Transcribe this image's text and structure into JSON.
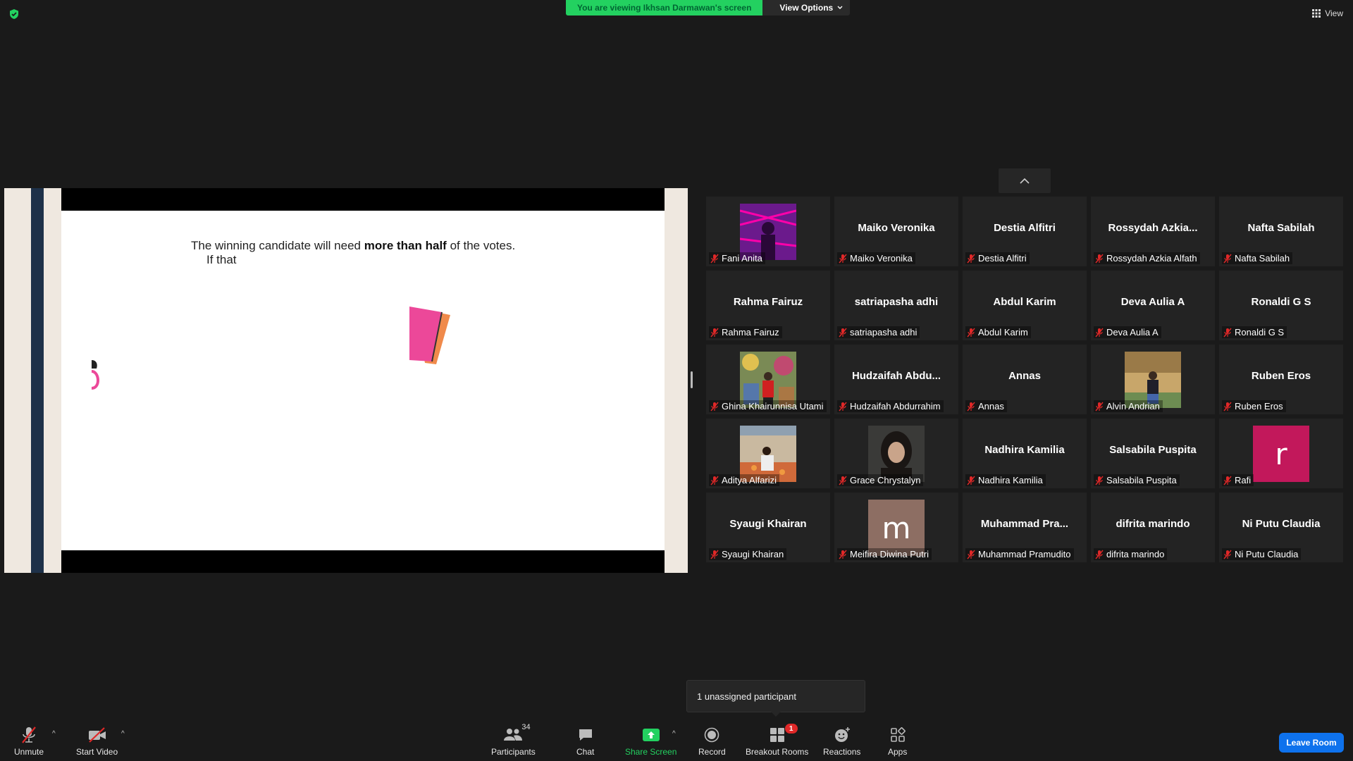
{
  "top": {
    "viewing_text": "You are viewing Ikhsan Darmawan's screen",
    "view_options_label": "View Options",
    "view_label": "View"
  },
  "slide": {
    "line1_pre": "The winning candidate will need ",
    "line1_bold": "more than half",
    "line1_post": " of the votes.",
    "line2": "If that"
  },
  "participants": [
    {
      "big": "",
      "name": "Fani Anita",
      "media": "photo-purple"
    },
    {
      "big": "Maiko Veronika",
      "name": "Maiko Veronika"
    },
    {
      "big": "Destia Alfitri",
      "name": "Destia Alfitri"
    },
    {
      "big": "Rossydah  Azkia...",
      "name": "Rossydah Azkia Alfath"
    },
    {
      "big": "Nafta Sabilah",
      "name": "Nafta Sabilah"
    },
    {
      "big": "Rahma Fairuz",
      "name": "Rahma Fairuz"
    },
    {
      "big": "satriapasha adhi",
      "name": "satriapasha adhi"
    },
    {
      "big": "Abdul Karim",
      "name": "Abdul Karim"
    },
    {
      "big": "Deva Aulia A",
      "name": "Deva Aulia A"
    },
    {
      "big": "Ronaldi G S",
      "name": "Ronaldi G S"
    },
    {
      "big": "",
      "name": "Ghina Khairunnisa Utami",
      "media": "photo-mural"
    },
    {
      "big": "Hudzaifah  Abdu...",
      "name": "Hudzaifah Abdurrahim"
    },
    {
      "big": "Annas",
      "name": "Annas"
    },
    {
      "big": "",
      "name": "Alvin Andrian",
      "media": "photo-outdoor"
    },
    {
      "big": "Ruben Eros",
      "name": "Ruben Eros"
    },
    {
      "big": "",
      "name": "Aditya Alfarizi",
      "media": "photo-market"
    },
    {
      "big": "",
      "name": "Grace Chrystalyn",
      "media": "photo-portrait"
    },
    {
      "big": "Nadhira Kamilia",
      "name": "Nadhira Kamilia"
    },
    {
      "big": "Salsabila Puspita",
      "name": "Salsabila Puspita"
    },
    {
      "big": "",
      "name": "Rafi",
      "media": "letter",
      "letter": "r",
      "color": "#c2185b"
    },
    {
      "big": "Syaugi Khairan",
      "name": "Syaugi Khairan"
    },
    {
      "big": "",
      "name": "Meifira Diwina Putri",
      "media": "letter",
      "letter": "m",
      "color": "#8d6e63"
    },
    {
      "big": "Muhammad  Pra...",
      "name": "Muhammad Pramudito"
    },
    {
      "big": "difrita marindo",
      "name": "difrita marindo"
    },
    {
      "big": "Ni Putu Claudia",
      "name": "Ni Putu Claudia"
    }
  ],
  "tooltip": "1 unassigned participant",
  "toolbar": {
    "unmute": "Unmute",
    "start_video": "Start Video",
    "participants": "Participants",
    "participants_count": "34",
    "chat": "Chat",
    "share_screen": "Share Screen",
    "record": "Record",
    "breakout_rooms": "Breakout Rooms",
    "breakout_badge": "1",
    "reactions": "Reactions",
    "apps": "Apps",
    "leave_room": "Leave Room"
  },
  "colors": {
    "share_green": "#23d160",
    "leave_blue": "#0e72ed",
    "mic_red": "#e02828",
    "rafi_avatar": "#c2185b",
    "meifira_avatar": "#8d6e63"
  }
}
